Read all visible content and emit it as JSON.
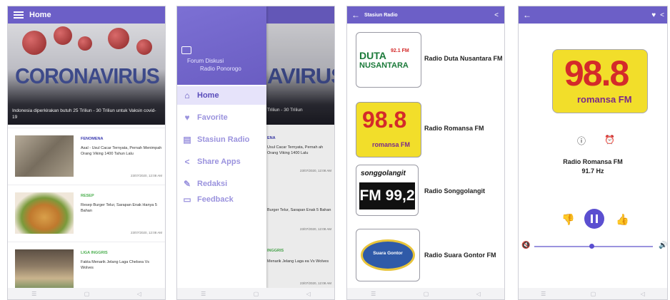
{
  "colors": {
    "primary": "#6c5fc7",
    "accent": "#5b4fd0",
    "drawer_text": "#9b93de"
  },
  "screen1": {
    "title": "Home",
    "hero": {
      "headline": "CORONAVIRUS",
      "caption": "Indonesia diperkirakan butuh 25 Triliun - 30 Triliun untuk Vaksin covid-19"
    },
    "articles": [
      {
        "category": "FENOMENA",
        "title": "Asal - Usul Cacar Ternyata, Pernah Menimpah Orang Viking 1400 Tahun Lalu",
        "date": "23/07/2020, 12:08 AM"
      },
      {
        "category": "RESEP",
        "title": "Resep Burger Telur, Sarapan Enak Hanya 5 Bahan",
        "date": "23/07/2020, 12:08 AM"
      },
      {
        "category": "LIGA INGGRIS",
        "title": "Fakta Menarik Jelang Laga Chelsea Vs Wolves",
        "date": "23/07/2020, 12:08 AM"
      }
    ]
  },
  "screen2": {
    "drawer_title_1": "Forum Diskusi",
    "drawer_title_2": "Radio Ponorogo",
    "items": [
      {
        "label": "Home",
        "icon": "home-icon"
      },
      {
        "label": "Favorite",
        "icon": "heart-icon"
      },
      {
        "label": "Stasiun Radio",
        "icon": "radio-icon"
      },
      {
        "label": "Share Apps",
        "icon": "share-icon"
      },
      {
        "label": "Redaksi",
        "icon": "tools-icon"
      },
      {
        "label": "Feedback",
        "icon": "feedback-icon"
      }
    ],
    "bg_headline": "AVIRUS",
    "bg_caption": "Triliun - 30 Triliun",
    "bg_snippets": [
      "ENA",
      "Usul Cacar Ternyata, Pernah ah Orang Viking 1400 Lalu",
      "23/07/2020, 12:08 AM",
      "Burger Telur, Sarapan Enak 5 Bahan",
      "23/07/2020, 12:08 AM",
      "INGGRIS",
      "Menarik Jelang Laga ea Vs Wolves",
      "23/07/2020, 12:08 AM"
    ]
  },
  "screen3": {
    "title": "Stasiun Radio",
    "stations": [
      {
        "name": "Radio Duta Nusantara FM",
        "logo_text_1": "DUTA",
        "logo_text_2": "NUSANTARA",
        "logo_freq": "92.1 FM"
      },
      {
        "name": "Radio Romansa FM",
        "logo_text_1": "98.8",
        "logo_text_2": "romansa FM"
      },
      {
        "name": "Radio Songgolangit",
        "logo_text_1": "songgolangit",
        "logo_text_2": "FM 99,2"
      },
      {
        "name": "Radio Suara Gontor FM",
        "logo_text_1": "Suara Gontor"
      }
    ]
  },
  "screen4": {
    "station_name": "Radio Romansa FM",
    "frequency": "91.7 Hz",
    "logo_text_1": "98.8",
    "logo_text_2": "romansa FM",
    "volume": 0.48
  }
}
